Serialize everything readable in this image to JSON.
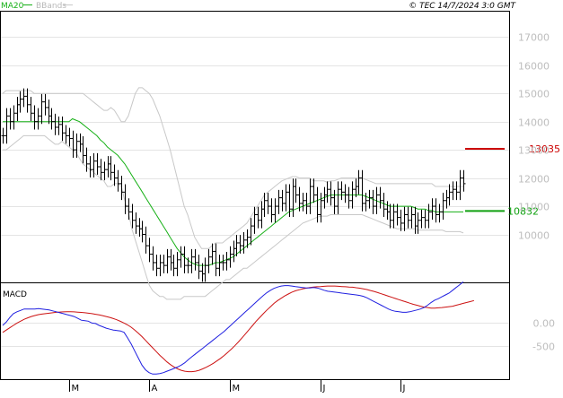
{
  "header": {
    "indicator_ma": "MA20",
    "indicator_bb": "BBands",
    "copyright": "© TEC 14/7/2024 3:0 GMT"
  },
  "macd_label": "MACD",
  "colors": {
    "price": "#000000",
    "ma20": "#16b016",
    "bbands": "#c8c8c8",
    "macd": "#1f1fe0",
    "signal": "#cc1111",
    "resistance": "#cc0000",
    "support": "#10a010",
    "grid": "#e4e4e4"
  },
  "chart_data": [
    {
      "type": "candlestick",
      "name": "price",
      "y_ticks": [
        10000,
        11000,
        12000,
        13000,
        14000,
        15000,
        16000,
        17000
      ],
      "y_tick_labels": [
        "10000",
        "11000",
        "12000",
        "13000",
        "14000",
        "15000",
        "16000",
        "17000"
      ],
      "ylim": [
        8300,
        17900
      ],
      "x_labels": [
        {
          "label": "M",
          "index": 19
        },
        {
          "label": "A",
          "index": 42
        },
        {
          "label": "M",
          "index": 65
        },
        {
          "label": "J",
          "index": 91
        },
        {
          "label": "J",
          "index": 114
        }
      ],
      "close": [
        13500,
        14200,
        14000,
        14300,
        14600,
        14800,
        14900,
        14600,
        14300,
        14000,
        14200,
        14700,
        14500,
        14200,
        14000,
        13800,
        13900,
        13600,
        13500,
        13400,
        13000,
        13300,
        13200,
        12800,
        12500,
        12300,
        12600,
        12400,
        12200,
        12300,
        12500,
        12200,
        12000,
        11800,
        11500,
        11000,
        10800,
        10500,
        10300,
        10200,
        10000,
        9600,
        9300,
        9000,
        8800,
        9000,
        8900,
        9200,
        9000,
        8800,
        9100,
        9300,
        8900,
        8900,
        9200,
        9000,
        8700,
        8600,
        8900,
        9200,
        9400,
        8800,
        9000,
        9000,
        9100,
        9300,
        9500,
        9700,
        9600,
        9800,
        9900,
        10300,
        10700,
        10500,
        10900,
        11200,
        11000,
        10700,
        11000,
        11300,
        11100,
        11500,
        10900,
        11700,
        11400,
        11100,
        11200,
        11000,
        11700,
        11400,
        10700,
        11200,
        11400,
        11600,
        11300,
        11000,
        11600,
        11500,
        11400,
        11200,
        11600,
        11700,
        12000,
        11100,
        11200,
        11300,
        11000,
        11400,
        11200,
        10900,
        10800,
        10500,
        10800,
        10600,
        10400,
        10700,
        10500,
        10700,
        10300,
        10500,
        10600,
        10500,
        10800,
        11000,
        10700,
        10800,
        11200,
        11300,
        11500,
        11600,
        11500,
        12000,
        11800
      ],
      "ma20": [
        14000,
        14000,
        14000,
        14000,
        14000,
        14000,
        14000,
        14000,
        14000,
        14000,
        14000,
        14000,
        14000,
        14000,
        14000,
        14000,
        14000,
        14000,
        14000,
        14000,
        14100,
        14050,
        14000,
        13900,
        13800,
        13700,
        13600,
        13500,
        13350,
        13250,
        13100,
        13000,
        12900,
        12800,
        12650,
        12500,
        12300,
        12100,
        11900,
        11700,
        11500,
        11300,
        11100,
        10900,
        10700,
        10500,
        10300,
        10100,
        9900,
        9700,
        9500,
        9350,
        9200,
        9100,
        9000,
        8950,
        8900,
        8900,
        8900,
        8900,
        8950,
        9000,
        9000,
        9050,
        9100,
        9150,
        9200,
        9300,
        9400,
        9500,
        9600,
        9700,
        9800,
        9900,
        10000,
        10100,
        10200,
        10300,
        10400,
        10500,
        10600,
        10700,
        10800,
        10850,
        10900,
        10950,
        11000,
        11050,
        11100,
        11150,
        11200,
        11250,
        11300,
        11350,
        11400,
        11400,
        11400,
        11400,
        11400,
        11400,
        11400,
        11400,
        11400,
        11400,
        11350,
        11300,
        11250,
        11200,
        11150,
        11100,
        11050,
        11000,
        11000,
        11000,
        11000,
        11000,
        11000,
        11000,
        10950,
        10900,
        10900,
        10900,
        10850,
        10850,
        10800,
        10800,
        10800,
        10800,
        10800,
        10800,
        10800,
        10800,
        10800
      ],
      "bb_upper": [
        15000,
        15100,
        15100,
        15100,
        15100,
        15100,
        15100,
        15100,
        15100,
        15000,
        15000,
        15000,
        15000,
        15000,
        15000,
        15000,
        15000,
        15000,
        15000,
        15000,
        15000,
        15000,
        15000,
        15000,
        14900,
        14800,
        14700,
        14600,
        14500,
        14400,
        14400,
        14500,
        14400,
        14200,
        14000,
        14000,
        14200,
        14600,
        15000,
        15200,
        15200,
        15100,
        15000,
        14800,
        14500,
        14200,
        13800,
        13400,
        13000,
        12500,
        12000,
        11500,
        11000,
        10700,
        10300,
        9900,
        9700,
        9500,
        9500,
        9500,
        9600,
        9700,
        9700,
        9700,
        9800,
        9900,
        10000,
        10100,
        10200,
        10300,
        10400,
        10600,
        10800,
        11000,
        11200,
        11400,
        11500,
        11600,
        11700,
        11800,
        11900,
        11950,
        12000,
        12050,
        12050,
        12000,
        12000,
        12000,
        12000,
        11900,
        11900,
        11900,
        11900,
        11850,
        11900,
        11900,
        11950,
        12000,
        12000,
        12000,
        12000,
        12000,
        12000,
        12000,
        11950,
        11900,
        11850,
        11800,
        11800,
        11800,
        11800,
        11800,
        11800,
        11800,
        11800,
        11800,
        11800,
        11800,
        11800,
        11800,
        11800,
        11800,
        11800,
        11800,
        11700,
        11700,
        11700,
        11700,
        11700,
        11700,
        11700,
        11700,
        11700
      ],
      "bb_lower": [
        13000,
        13000,
        13100,
        13200,
        13300,
        13400,
        13500,
        13500,
        13500,
        13500,
        13500,
        13500,
        13500,
        13400,
        13300,
        13200,
        13200,
        13300,
        13200,
        13100,
        13000,
        12900,
        12700,
        12500,
        12400,
        12300,
        12200,
        12100,
        12000,
        11900,
        11700,
        11700,
        11800,
        11800,
        11700,
        11200,
        10800,
        10200,
        9800,
        9400,
        9000,
        8600,
        8200,
        8000,
        7900,
        7800,
        7800,
        7700,
        7700,
        7700,
        7700,
        7700,
        7800,
        7800,
        7800,
        7800,
        7800,
        7800,
        7800,
        7900,
        8000,
        8100,
        8200,
        8300,
        8400,
        8400,
        8500,
        8600,
        8700,
        8800,
        8800,
        8900,
        9000,
        9100,
        9200,
        9300,
        9400,
        9500,
        9600,
        9700,
        9800,
        9900,
        10000,
        10100,
        10200,
        10300,
        10400,
        10450,
        10500,
        10550,
        10600,
        10650,
        10650,
        10650,
        10700,
        10700,
        10700,
        10700,
        10700,
        10700,
        10700,
        10700,
        10700,
        10700,
        10650,
        10600,
        10550,
        10500,
        10450,
        10400,
        10350,
        10300,
        10250,
        10200,
        10200,
        10200,
        10200,
        10200,
        10200,
        10150,
        10150,
        10150,
        10150,
        10150,
        10150,
        10150,
        10150,
        10100,
        10100,
        10100,
        10100,
        10100,
        10050
      ],
      "support": {
        "value": 10832,
        "label": "10832"
      },
      "resistance": {
        "value": 13035,
        "label": "13035"
      }
    },
    {
      "type": "line",
      "name": "MACD",
      "y_ticks": [
        0,
        -500
      ],
      "y_tick_labels": [
        "0.00",
        "-500"
      ],
      "ylim": [
        -1200,
        850
      ],
      "macd": [
        -50,
        20,
        120,
        200,
        240,
        270,
        300,
        300,
        300,
        300,
        310,
        300,
        290,
        280,
        260,
        240,
        220,
        200,
        180,
        160,
        140,
        100,
        60,
        50,
        40,
        0,
        -10,
        -50,
        -80,
        -110,
        -130,
        -150,
        -160,
        -170,
        -200,
        -320,
        -450,
        -600,
        -750,
        -900,
        -1000,
        -1060,
        -1090,
        -1090,
        -1080,
        -1060,
        -1030,
        -1000,
        -970,
        -940,
        -900,
        -850,
        -780,
        -720,
        -660,
        -600,
        -540,
        -480,
        -420,
        -360,
        -300,
        -240,
        -180,
        -110,
        -40,
        30,
        100,
        170,
        240,
        310,
        380,
        450,
        520,
        590,
        650,
        700,
        740,
        770,
        790,
        800,
        800,
        790,
        780,
        770,
        760,
        750,
        750,
        760,
        750,
        730,
        700,
        680,
        670,
        660,
        650,
        640,
        630,
        620,
        610,
        600,
        590,
        570,
        540,
        500,
        460,
        420,
        380,
        340,
        300,
        270,
        250,
        240,
        230,
        230,
        240,
        260,
        280,
        300,
        330,
        380,
        440,
        490,
        520,
        560,
        600,
        640,
        700,
        760,
        820,
        880
      ],
      "signal": [
        -200,
        -150,
        -100,
        -50,
        0,
        40,
        80,
        110,
        140,
        160,
        180,
        190,
        200,
        210,
        220,
        230,
        235,
        238,
        240,
        240,
        238,
        234,
        228,
        220,
        210,
        200,
        188,
        174,
        158,
        140,
        120,
        96,
        68,
        36,
        0,
        -40,
        -90,
        -150,
        -220,
        -290,
        -370,
        -450,
        -530,
        -610,
        -690,
        -760,
        -830,
        -890,
        -940,
        -980,
        -1010,
        -1030,
        -1040,
        -1040,
        -1030,
        -1010,
        -980,
        -945,
        -905,
        -860,
        -810,
        -755,
        -695,
        -630,
        -560,
        -485,
        -405,
        -320,
        -230,
        -140,
        -50,
        40,
        120,
        200,
        280,
        350,
        420,
        480,
        530,
        580,
        620,
        660,
        690,
        710,
        730,
        745,
        760,
        770,
        775,
        780,
        785,
        790,
        790,
        790,
        785,
        780,
        775,
        770,
        765,
        755,
        745,
        730,
        715,
        695,
        675,
        650,
        625,
        600,
        575,
        550,
        525,
        500,
        475,
        450,
        425,
        400,
        380,
        360,
        340,
        330,
        320,
        320,
        325,
        330,
        340,
        350,
        360,
        380,
        400,
        420,
        440,
        460,
        480
      ]
    }
  ]
}
